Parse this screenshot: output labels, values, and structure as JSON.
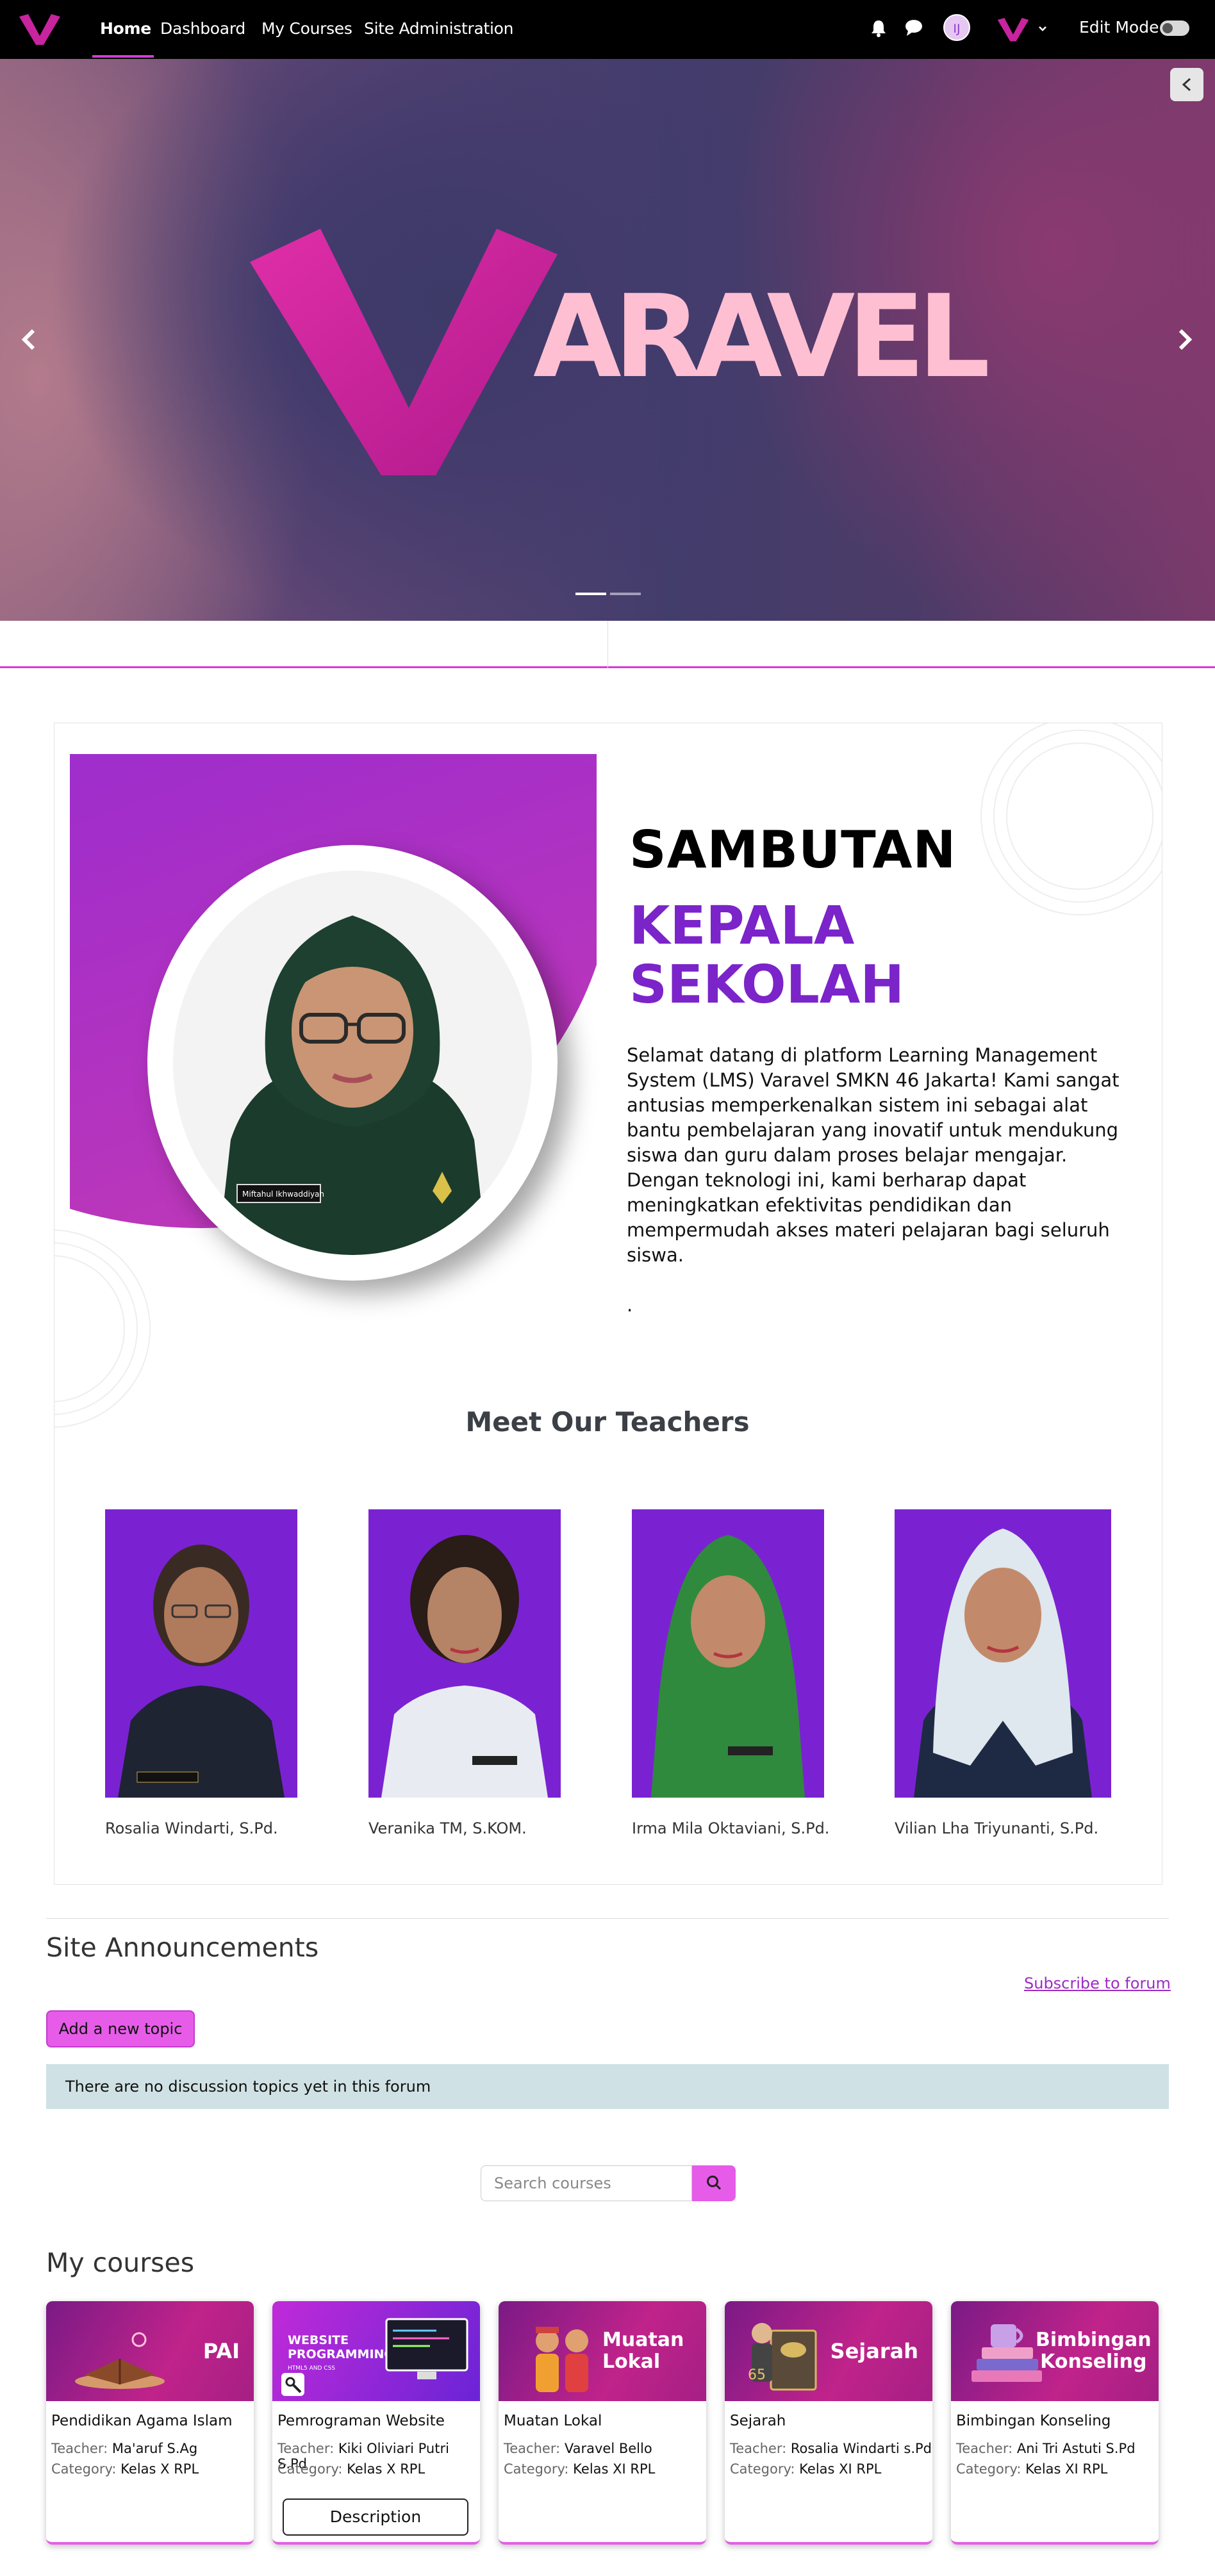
{
  "navbar": {
    "items": [
      "Home",
      "Dashboard",
      "My Courses",
      "Site Administration"
    ],
    "avatar_initials": "IJ",
    "edit_mode_label": "Edit Mode"
  },
  "hero": {
    "brand_text": "ARAVEL"
  },
  "welcome": {
    "title_line1": "SAMBUTAN",
    "title_line2": "KEPALA SEKOLAH",
    "paragraph": "Selamat datang di platform Learning Management System (LMS) Varavel SMKN 46 Jakarta! Kami sangat antusias memperkenalkan sistem ini sebagai alat bantu pembelajaran yang inovatif untuk mendukung siswa dan guru dalam proses belajar mengajar. Dengan teknologi ini, kami berharap dapat meningkatkan efektivitas pendidikan dan mempermudah akses materi pelajaran bagi seluruh siswa.",
    "dot": ".",
    "photo_badge": "Miftahul Ikhwaddiyah"
  },
  "teachers": {
    "title": "Meet Our Teachers",
    "list": [
      {
        "name": "Rosalia Windarti, S.Pd."
      },
      {
        "name": "Veranika TM, S.KOM."
      },
      {
        "name": "Irma Mila Oktaviani, S.Pd."
      },
      {
        "name": "Vilian Lha Triyunanti, S.Pd."
      }
    ]
  },
  "announcements": {
    "title": "Site Announcements",
    "subscribe_label": "Subscribe to forum",
    "add_topic_label": "Add a new topic",
    "empty_notice": "There are no discussion topics yet in this forum"
  },
  "search": {
    "placeholder": "Search courses"
  },
  "my_courses": {
    "title": "My courses",
    "teacher_label": "Teacher:",
    "category_label": "Category:",
    "description_label": "Description",
    "courses": [
      {
        "image_label": "PAI",
        "name": "Pendidikan Agama Islam",
        "teacher": "Ma'aruf S.Ag",
        "category": "Kelas X RPL"
      },
      {
        "image_label": "WEBSITE PROGRAMMING",
        "image_sub": "HTML5 AND CSS",
        "name": "Pemrograman Website",
        "teacher": "Kiki Oliviari Putri S.Pd",
        "category": "Kelas X RPL"
      },
      {
        "image_label": "Muatan Lokal",
        "name": "Muatan Lokal",
        "teacher": "Varavel Bello",
        "category": "Kelas XI RPL"
      },
      {
        "image_label": "Sejarah",
        "name": "Sejarah",
        "teacher": "Rosalia Windarti s.Pd",
        "category": "Kelas XI RPL"
      },
      {
        "image_label": "Bimbingan Konseling",
        "name": "Bimbingan Konseling",
        "teacher": "Ani Tri Astuti S.Pd",
        "category": "Kelas XI RPL"
      }
    ]
  },
  "colors": {
    "accent": "#e65ce8",
    "brand_purple": "#7b24c9",
    "navbar_bg": "#000000"
  }
}
